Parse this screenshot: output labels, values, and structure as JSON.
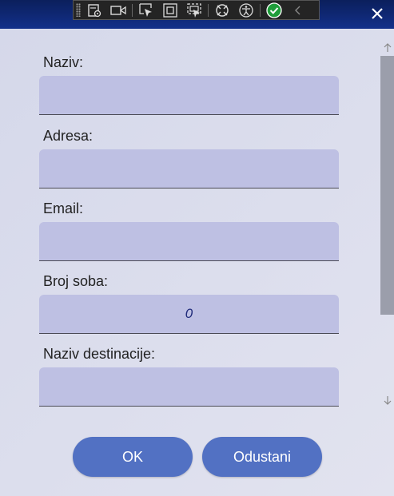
{
  "window": {
    "close_label": "✕"
  },
  "form": {
    "fields": [
      {
        "label": "Naziv:",
        "value": ""
      },
      {
        "label": "Adresa:",
        "value": ""
      },
      {
        "label": "Email:",
        "value": ""
      },
      {
        "label": "Broj soba:",
        "value": "0"
      },
      {
        "label": "Naziv destinacije:",
        "value": ""
      }
    ]
  },
  "buttons": {
    "ok_label": "OK",
    "cancel_label": "Odustani"
  },
  "debug_toolbar": {
    "icons": [
      "live-visual-tree-icon",
      "record-icon",
      "select-element-icon",
      "display-layout-adorners-icon",
      "track-focus-icon",
      "hot-reload-icon",
      "accessibility-icon",
      "binding-ok-icon",
      "collapse-icon"
    ]
  },
  "colors": {
    "titlebar": "#13308a",
    "field_bg": "#bec0e3",
    "button_bg": "#5271c3",
    "check_green": "#1f9d3a"
  }
}
